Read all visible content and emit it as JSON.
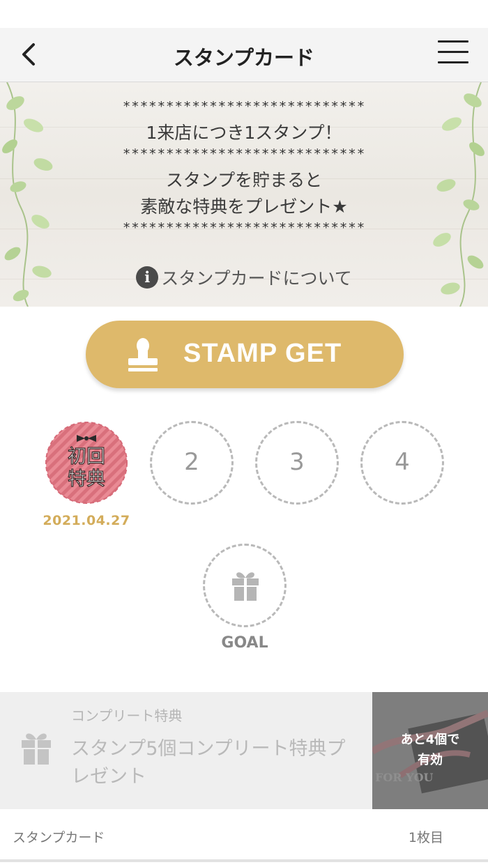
{
  "header": {
    "title": "スタンプカード"
  },
  "banner": {
    "stars": "****************************",
    "line1": "1来店につき1スタンプ！",
    "line2a": "スタンプを貯まると",
    "line2b": "素敵な特典をプレゼント★",
    "about_label": "スタンプカードについて"
  },
  "stamp_button": {
    "label": "STAMP GET"
  },
  "stamps": {
    "first_text_1": "初回",
    "first_text_2": "特典",
    "first_date": "2021.04.27",
    "slot2": "2",
    "slot3": "3",
    "slot4": "4",
    "goal_label": "GOAL"
  },
  "reward": {
    "category": "コンプリート特典",
    "description": "スタンプ5個コンプリート特典プレゼント",
    "remaining": "あと4個で",
    "valid": "有効",
    "thumb_caption": "FOR YOU"
  },
  "footer": {
    "left": "スタンプカード",
    "right": "1枚目"
  },
  "colors": {
    "accent_gold": "#deb96b",
    "date_gold": "#d3ac5a",
    "first_stamp_pink": "#e8838e"
  }
}
